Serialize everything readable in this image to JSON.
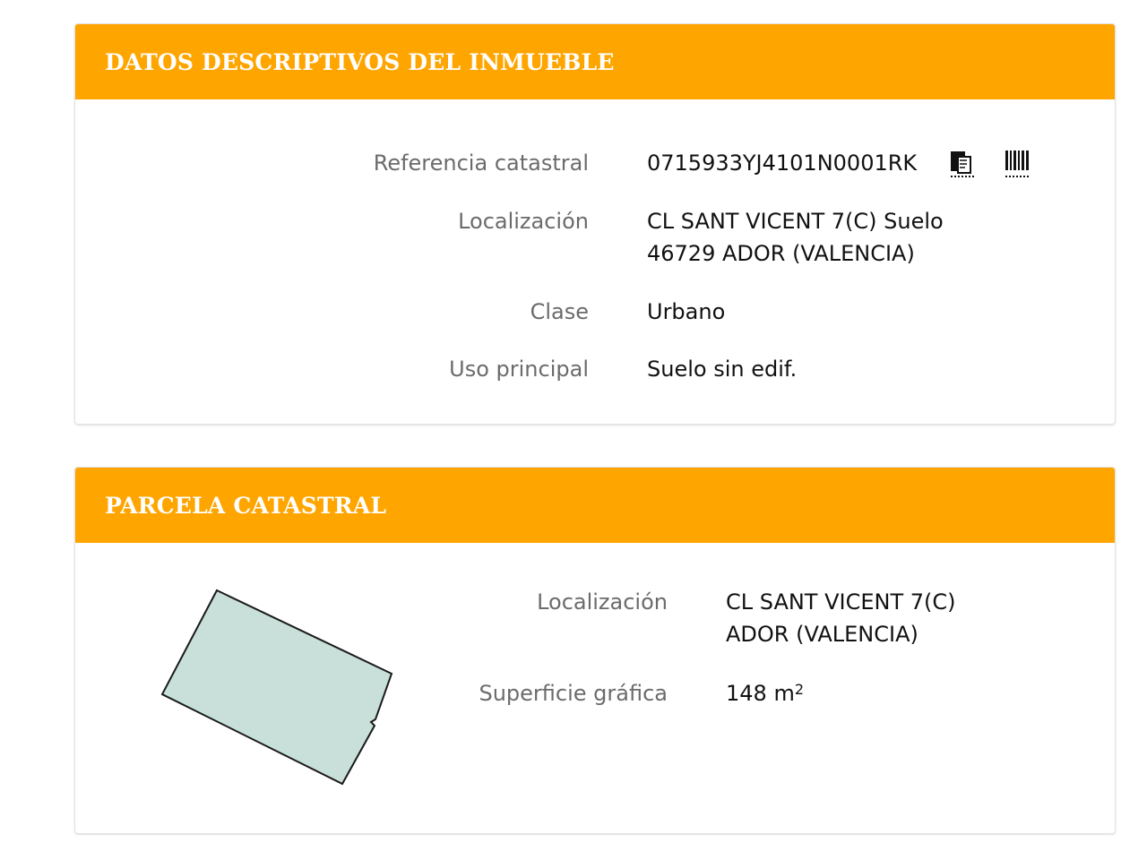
{
  "descriptivos": {
    "title": "DATOS DESCRIPTIVOS DEL INMUEBLE",
    "referencia": {
      "label": "Referencia catastral",
      "value": "0715933YJ4101N0001RK"
    },
    "localizacion": {
      "label": "Localización",
      "line1": "CL SANT VICENT 7(C) Suelo",
      "line2": "46729 ADOR (VALENCIA)"
    },
    "clase": {
      "label": "Clase",
      "value": "Urbano"
    },
    "uso": {
      "label": "Uso principal",
      "value": "Suelo sin edif."
    }
  },
  "parcela": {
    "title": "PARCELA CATASTRAL",
    "localizacion": {
      "label": "Localización",
      "line1": "CL SANT VICENT 7(C)",
      "line2": "ADOR (VALENCIA)"
    },
    "superficie": {
      "label": "Superficie gráfica",
      "value": "148 m",
      "unit_sup": "2"
    }
  },
  "colors": {
    "header_bg": "#ffa500",
    "parcel_fill": "#c8e0d9",
    "label_text": "#6b6b6b"
  },
  "icons": [
    "copy-icon",
    "barcode-icon"
  ]
}
